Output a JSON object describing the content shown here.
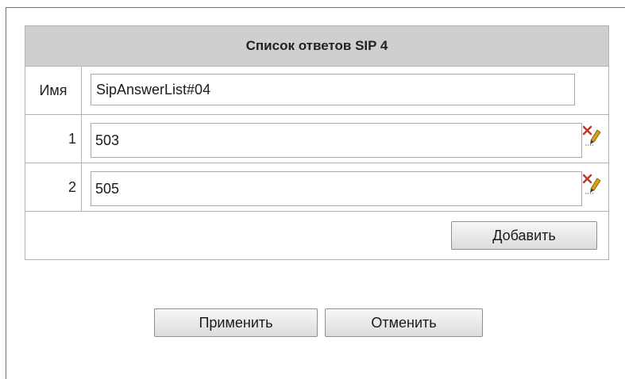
{
  "panel": {
    "title": "Список ответов SIP 4",
    "name_label": "Имя",
    "name_value": "SipAnswerList#04"
  },
  "answers": [
    {
      "index": "1",
      "value": "503"
    },
    {
      "index": "2",
      "value": "505"
    }
  ],
  "row_icons": [
    "delete-icon",
    "edit-icon"
  ],
  "buttons": {
    "add": "Добавить",
    "apply": "Применить",
    "cancel": "Отменить"
  },
  "colors": {
    "header_bg": "#cfcfcf",
    "delete_icon": "#c0392b",
    "edit_icon": "#d4a017"
  }
}
